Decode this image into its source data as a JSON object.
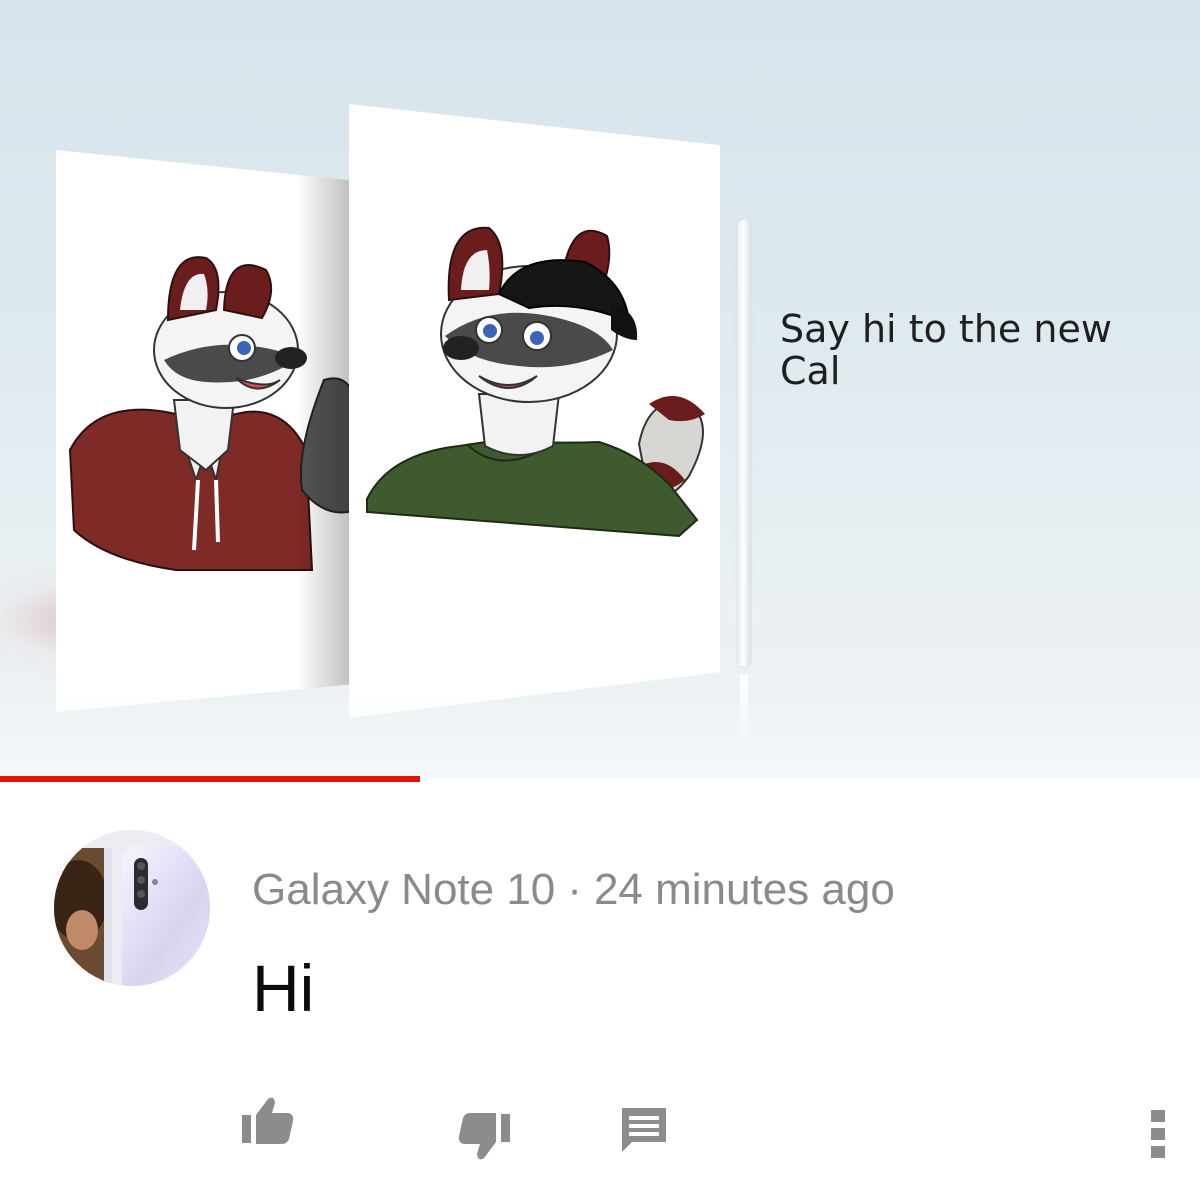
{
  "video": {
    "headline": "Say hi to the new Cal",
    "progress_percent": 35
  },
  "comment": {
    "author": "Galaxy Note 10",
    "separator": "·",
    "time": "24 minutes ago",
    "text": "Hi"
  },
  "icons": {
    "like": "thumbs-up-icon",
    "dislike": "thumbs-down-icon",
    "reply": "comment-icon",
    "more": "more-vertical-icon"
  },
  "colors": {
    "accent": "#e3120b",
    "meta_text": "#8a8a8a",
    "icon": "#8c8c8c"
  }
}
